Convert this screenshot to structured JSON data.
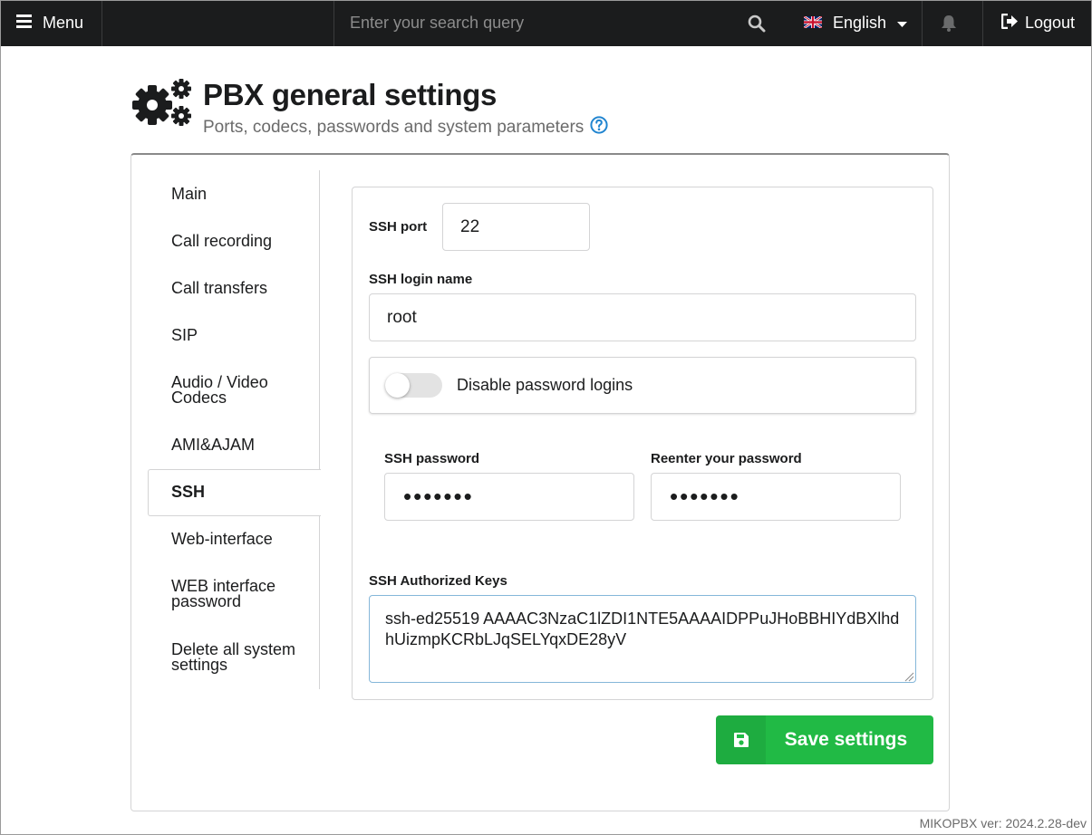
{
  "topbar": {
    "menu_label": "Menu",
    "search_placeholder": "Enter your search query",
    "language": "English",
    "logout_label": "Logout"
  },
  "header": {
    "title": "PBX general settings",
    "subtitle": "Ports, codecs, passwords and system parameters"
  },
  "sidebar": {
    "items": [
      {
        "label": "Main"
      },
      {
        "label": "Call recording"
      },
      {
        "label": "Call transfers"
      },
      {
        "label": "SIP"
      },
      {
        "label": "Audio / Video Codecs"
      },
      {
        "label": "AMI&AJAM"
      },
      {
        "label": "SSH",
        "active": true
      },
      {
        "label": "Web-interface"
      },
      {
        "label": "WEB interface password"
      },
      {
        "label": "Delete all system settings"
      }
    ]
  },
  "ssh": {
    "port_label": "SSH port",
    "port_value": "22",
    "login_label": "SSH login name",
    "login_value": "root",
    "disable_password_label": "Disable password logins",
    "disable_password_on": false,
    "password_label": "SSH password",
    "password_value": "•••••••",
    "reenter_label": "Reenter your password",
    "reenter_value": "•••••••",
    "keys_label": "SSH Authorized Keys",
    "keys_value": "ssh-ed25519 AAAAC3NzaC1lZDI1NTE5AAAAIDPPuJHoBBHIYdBXlhdhUizmpKCRbLJqSELYqxDE28yV"
  },
  "save_label": "Save settings",
  "version": "MIKOPBX ver: 2024.2.28-dev",
  "colors": {
    "topbar": "#1b1c1d",
    "save_green": "#21ba45",
    "help_blue": "#2185d0"
  }
}
